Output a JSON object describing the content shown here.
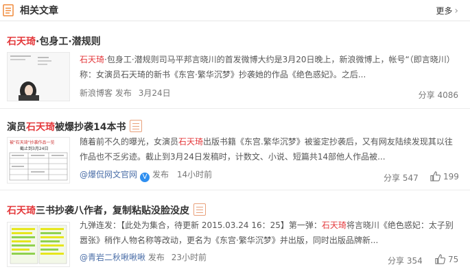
{
  "header": {
    "title": "相关文章",
    "more_label": "更多"
  },
  "articles": [
    {
      "title_hl": "石天琦",
      "title_rest": "·包身工·潜规则",
      "summary_hl": "石天琦",
      "summary_rest": "·包身工·潜规则司马平邦言晓川的首发微博大约是3月20日晚上，新浪微博上，帐号“（即言晓川）称：女演员石天琦的新书《东宫·繁华沉梦》抄袭她的作品《绝色惑妃》。之后...",
      "source": "新浪博客",
      "publish_label": "发布",
      "time": "3月24日",
      "share_label": "分享",
      "share_count": "4086"
    },
    {
      "title_pre": "演员",
      "title_hl": "石天琦",
      "title_rest": "被爆抄袭14本书",
      "summary_pre": "随着前不久的曝光，女演员",
      "summary_hl": "石天琦",
      "summary_rest": "出版书籍《东宫.繁华沉梦》被鉴定抄袭后，又有网友陆续发现其以往作品也不乏劣迹。截止到3月24日发稿时，计数文、小说、短篇共14部他人作品被...",
      "source": "@爆侃网文官网",
      "publish_label": "发布",
      "time": "14小时前",
      "share_label": "分享",
      "share_count": "547",
      "like_count": "199",
      "thumb_caption": "截止到3月24日",
      "thumb_heading": "被\"石天琦\"抄袭作品一览"
    },
    {
      "title_hl": "石天琦",
      "title_rest": "三书抄袭八作者，复制粘贴没脸没皮",
      "summary_pre": "九弹连发：【此处为集合，待更新 2015.03.24 16：25】第一弹：",
      "summary_hl": "石天琦",
      "summary_rest": "将言晓川《绝色惑妃：太子别嚣张》稍作人物名称等改动，更名为《东宫·繁华沉梦》并出版，同时出版品牌新...",
      "source": "@青岩二秋啾啾啾",
      "publish_label": "发布",
      "time": "23小时前",
      "share_label": "分享",
      "share_count": "354",
      "like_count": "75"
    }
  ],
  "colors": {
    "highlight": "#e4393c",
    "source_link": "#4c6fa8",
    "verified": "#2f8ff0"
  }
}
